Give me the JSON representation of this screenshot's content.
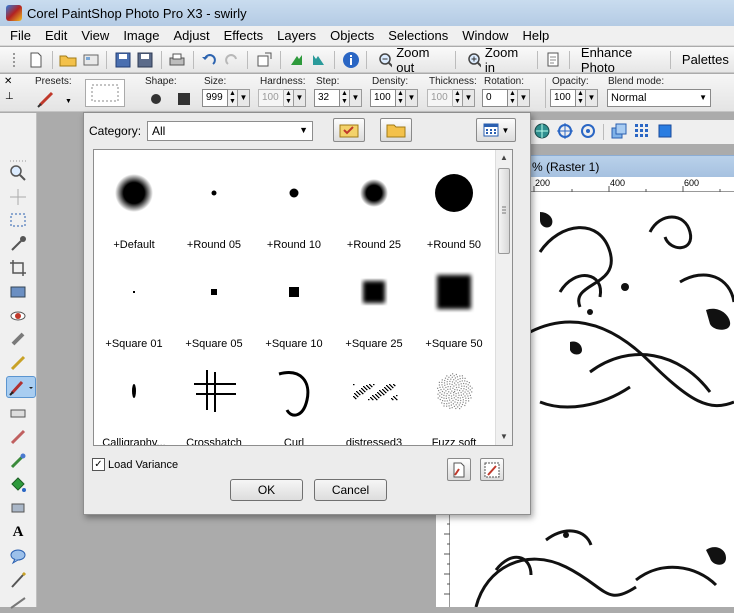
{
  "window": {
    "title": "Corel PaintShop Photo Pro X3 - swirly"
  },
  "menu": [
    {
      "label": "File"
    },
    {
      "label": "Edit"
    },
    {
      "label": "View"
    },
    {
      "label": "Image"
    },
    {
      "label": "Adjust"
    },
    {
      "label": "Effects"
    },
    {
      "label": "Layers"
    },
    {
      "label": "Objects"
    },
    {
      "label": "Selections"
    },
    {
      "label": "Window"
    },
    {
      "label": "Help"
    }
  ],
  "toolbar": {
    "zoom_out": "Zoom out",
    "zoom_in": "Zoom in",
    "enhance_photo": "Enhance Photo",
    "palettes": "Palettes"
  },
  "tool_options": {
    "presets_label": "Presets:",
    "shape_label": "Shape:",
    "size_label": "Size:",
    "size_value": "999",
    "hardness_label": "Hardness:",
    "hardness_value": "100",
    "step_label": "Step:",
    "step_value": "32",
    "density_label": "Density:",
    "density_value": "100",
    "thickness_label": "Thickness:",
    "thickness_value": "100",
    "rotation_label": "Rotation:",
    "rotation_value": "0",
    "opacity_label": "Opacity:",
    "opacity_value": "100",
    "blend_label": "Blend mode:",
    "blend_value": "Normal"
  },
  "image_window": {
    "title_fragment": "% (Raster 1)",
    "ruler_ticks": [
      "200",
      "400",
      "600"
    ]
  },
  "dialog": {
    "category_label": "Category:",
    "category_value": "All",
    "brushes": [
      {
        "name": "+Default",
        "kind": "soft-circle",
        "size": 34
      },
      {
        "name": "+Round 05",
        "kind": "hard-circle",
        "size": 5
      },
      {
        "name": "+Round 10",
        "kind": "hard-circle",
        "size": 9
      },
      {
        "name": "+Round 25",
        "kind": "soft-circle",
        "size": 24
      },
      {
        "name": "+Round 50",
        "kind": "hard-circle",
        "size": 38
      },
      {
        "name": "+Square 01",
        "kind": "square",
        "size": 2
      },
      {
        "name": "+Square 05",
        "kind": "square",
        "size": 6
      },
      {
        "name": "+Square 10",
        "kind": "square",
        "size": 10
      },
      {
        "name": "+Square 25",
        "kind": "square-soft",
        "size": 22
      },
      {
        "name": "+Square 50",
        "kind": "square-soft",
        "size": 34
      },
      {
        "name": "Calligraphy...",
        "kind": "calligraphy",
        "size": 14
      },
      {
        "name": "Crosshatch",
        "kind": "crosshatch",
        "size": 40
      },
      {
        "name": "Curl",
        "kind": "curl",
        "size": 40
      },
      {
        "name": "distressed3",
        "kind": "distressed",
        "size": 40
      },
      {
        "name": "Fuzz soft",
        "kind": "fuzz",
        "size": 36
      }
    ],
    "load_variance_label": "Load Variance",
    "load_variance_checked": "✓",
    "ok_label": "OK",
    "cancel_label": "Cancel"
  }
}
